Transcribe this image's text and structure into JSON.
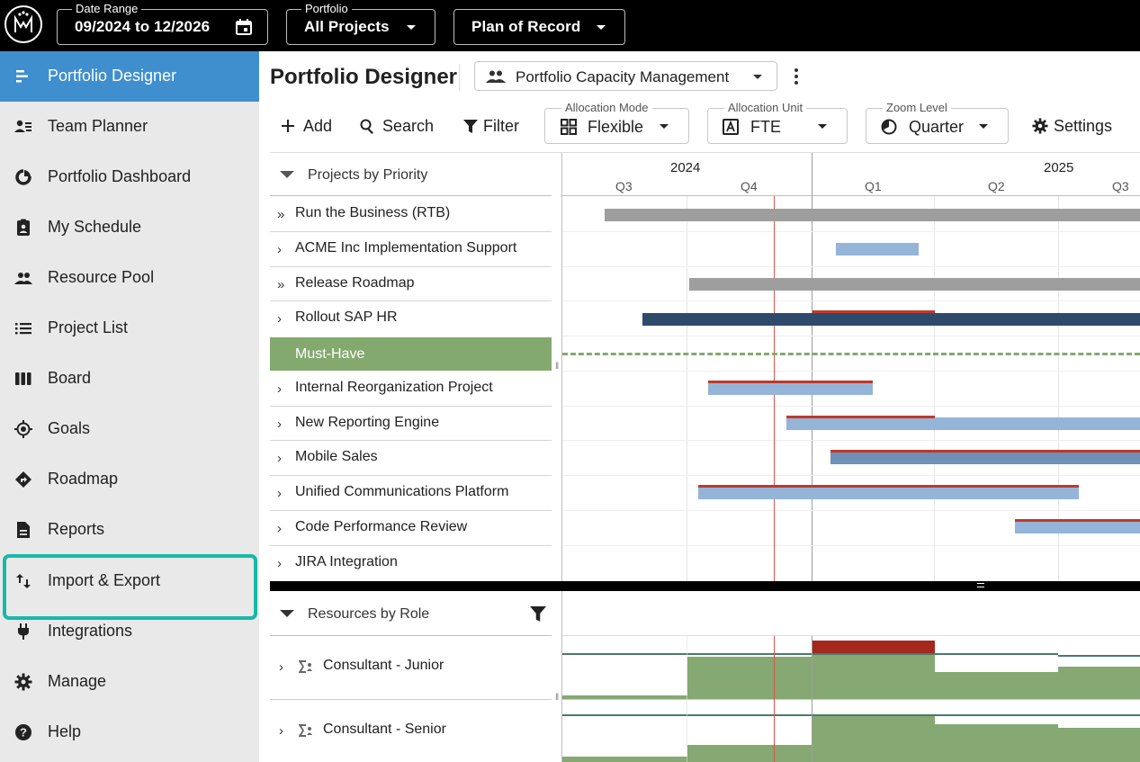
{
  "topbar": {
    "date_range_label": "Date Range",
    "date_range_value": "09/2024 to 12/2026",
    "portfolio_label": "Portfolio",
    "portfolio_value": "All Projects",
    "plan_value": "Plan of Record"
  },
  "sidebar": {
    "items": [
      {
        "label": "Portfolio Designer",
        "icon": "designer-icon"
      },
      {
        "label": "Team Planner",
        "icon": "team-planner-icon"
      },
      {
        "label": "Portfolio Dashboard",
        "icon": "dashboard-icon"
      },
      {
        "label": "My Schedule",
        "icon": "schedule-icon"
      },
      {
        "label": "Resource Pool",
        "icon": "people-icon"
      },
      {
        "label": "Project List",
        "icon": "list-icon"
      },
      {
        "label": "Board",
        "icon": "board-icon"
      },
      {
        "label": "Goals",
        "icon": "goals-icon"
      },
      {
        "label": "Roadmap",
        "icon": "roadmap-icon"
      },
      {
        "label": "Reports",
        "icon": "report-icon"
      },
      {
        "label": "Import & Export",
        "icon": "import-export-icon"
      },
      {
        "label": "Integrations",
        "icon": "plug-icon"
      },
      {
        "label": "Manage",
        "icon": "gear-icon"
      },
      {
        "label": "Help",
        "icon": "help-icon"
      }
    ],
    "active_index": 0
  },
  "main": {
    "title": "Portfolio Designer",
    "view_select": "Portfolio Capacity Management",
    "toolbar": {
      "add": "Add",
      "search": "Search",
      "filter": "Filter",
      "allocation_mode_label": "Allocation Mode",
      "allocation_mode_value": "Flexible",
      "allocation_unit_label": "Allocation Unit",
      "allocation_unit_value": "FTE",
      "zoom_label": "Zoom Level",
      "zoom_value": "Quarter",
      "settings": "Settings"
    },
    "projects_header": "Projects by Priority",
    "projects": [
      {
        "label": "Run the Business (RTB)",
        "chevron": "»"
      },
      {
        "label": "ACME Inc Implementation Support",
        "chevron": "›"
      },
      {
        "label": "Release Roadmap",
        "chevron": "»"
      },
      {
        "label": "Rollout SAP HR",
        "chevron": "›"
      },
      {
        "label": "Must-Have",
        "chevron": ""
      },
      {
        "label": "Internal Reorganization Project",
        "chevron": "›"
      },
      {
        "label": "New Reporting Engine",
        "chevron": "›"
      },
      {
        "label": "Mobile Sales",
        "chevron": "›"
      },
      {
        "label": "Unified Communications Platform",
        "chevron": "›"
      },
      {
        "label": "Code Performance Review",
        "chevron": "›"
      },
      {
        "label": "JIRA Integration",
        "chevron": "›"
      }
    ],
    "resources_header": "Resources by Role",
    "resources": [
      {
        "label": "Consultant - Junior"
      },
      {
        "label": "Consultant - Senior"
      }
    ],
    "timeline": {
      "years": [
        "2024",
        "2025"
      ],
      "quarters": [
        "Q3",
        "Q4",
        "Q1",
        "Q2",
        "Q3"
      ]
    }
  },
  "colors": {
    "accent": "#3f8fcf",
    "must_have": "#84a96f",
    "bar_gray": "#9e9e9e",
    "bar_light_blue": "#94b5d8",
    "bar_dark_blue": "#2d4a6b",
    "bar_mid_blue": "#6f90b6",
    "today_line": "#d9534f",
    "highlight": "#18b8a8",
    "capacity_green": "#86a873",
    "overload_red": "#a5281e"
  }
}
